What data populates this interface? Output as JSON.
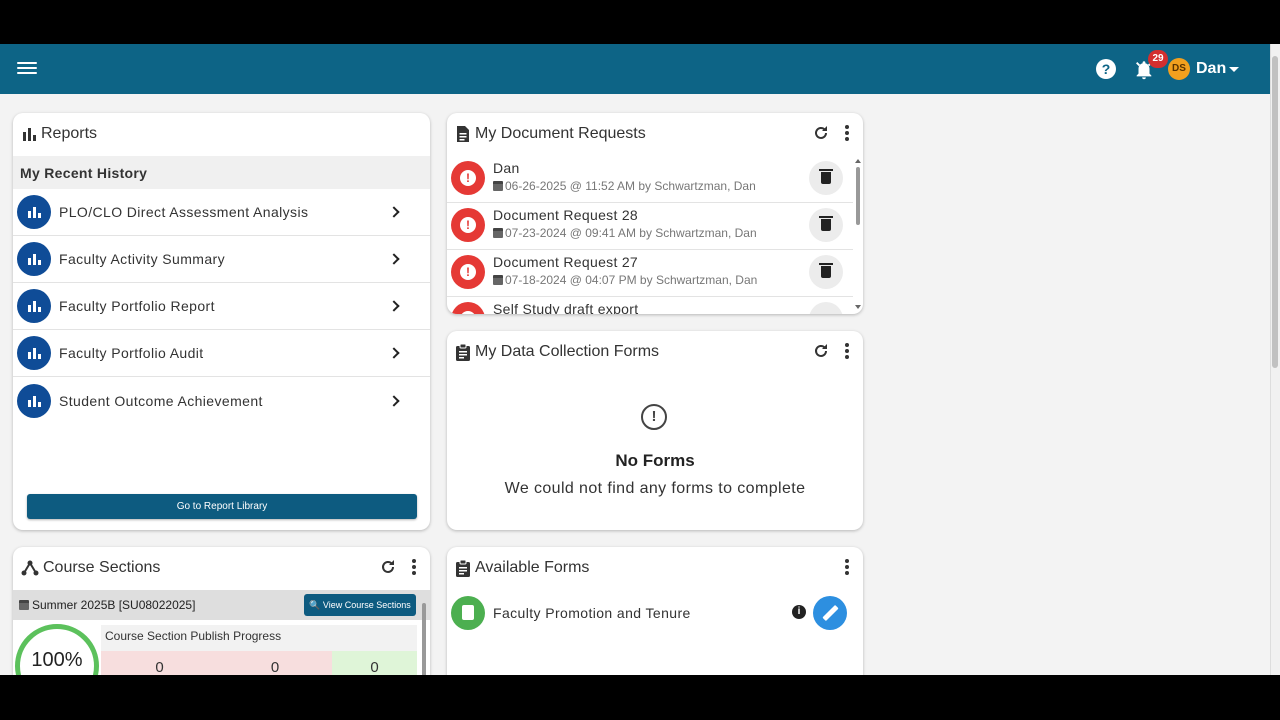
{
  "colors": {
    "header_bg": "#0d6486",
    "report_icon": "#0f4c97",
    "alert": "#e53935",
    "progress_ring": "#5cc15c",
    "form_icon": "#4caf50",
    "edit_button": "#2d8fe0",
    "badge": "#d32f2f"
  },
  "header": {
    "notification_count": "29",
    "avatar_initials": "DS",
    "user_name": "Dan",
    "help_glyph": "?"
  },
  "reports": {
    "title": "Reports",
    "history_header": "My Recent History",
    "items": [
      {
        "label": "PLO/CLO Direct Assessment Analysis"
      },
      {
        "label": "Faculty Activity Summary"
      },
      {
        "label": "Faculty Portfolio Report"
      },
      {
        "label": "Faculty Portfolio Audit"
      },
      {
        "label": "Student Outcome Achievement"
      }
    ],
    "library_button": "Go to Report Library"
  },
  "document_requests": {
    "title": "My Document Requests",
    "items": [
      {
        "title": "Dan",
        "meta": "06-26-2025 @ 11:52 AM by Schwartzman, Dan"
      },
      {
        "title": "Document Request 28",
        "meta": "07-23-2024 @ 09:41 AM by Schwartzman, Dan"
      },
      {
        "title": "Document Request 27",
        "meta": "07-18-2024 @ 04:07 PM by Schwartzman, Dan"
      },
      {
        "title": "Self Study draft export",
        "meta": ""
      }
    ]
  },
  "data_collection": {
    "title": "My Data Collection Forms",
    "empty_glyph": "!",
    "empty_title": "No Forms",
    "empty_message": "We could not find any forms to complete"
  },
  "course_sections": {
    "title": "Course Sections",
    "term": "Summer 2025B [SU08022025]",
    "view_button": "View Course Sections",
    "progress_percent": "100%",
    "progress_value": 100,
    "publish_title": "Course Section Publish Progress",
    "publish_counts": [
      "0",
      "0",
      "0"
    ]
  },
  "available_forms": {
    "title": "Available Forms",
    "items": [
      {
        "label": "Faculty Promotion and Tenure",
        "info_glyph": "i"
      }
    ]
  }
}
